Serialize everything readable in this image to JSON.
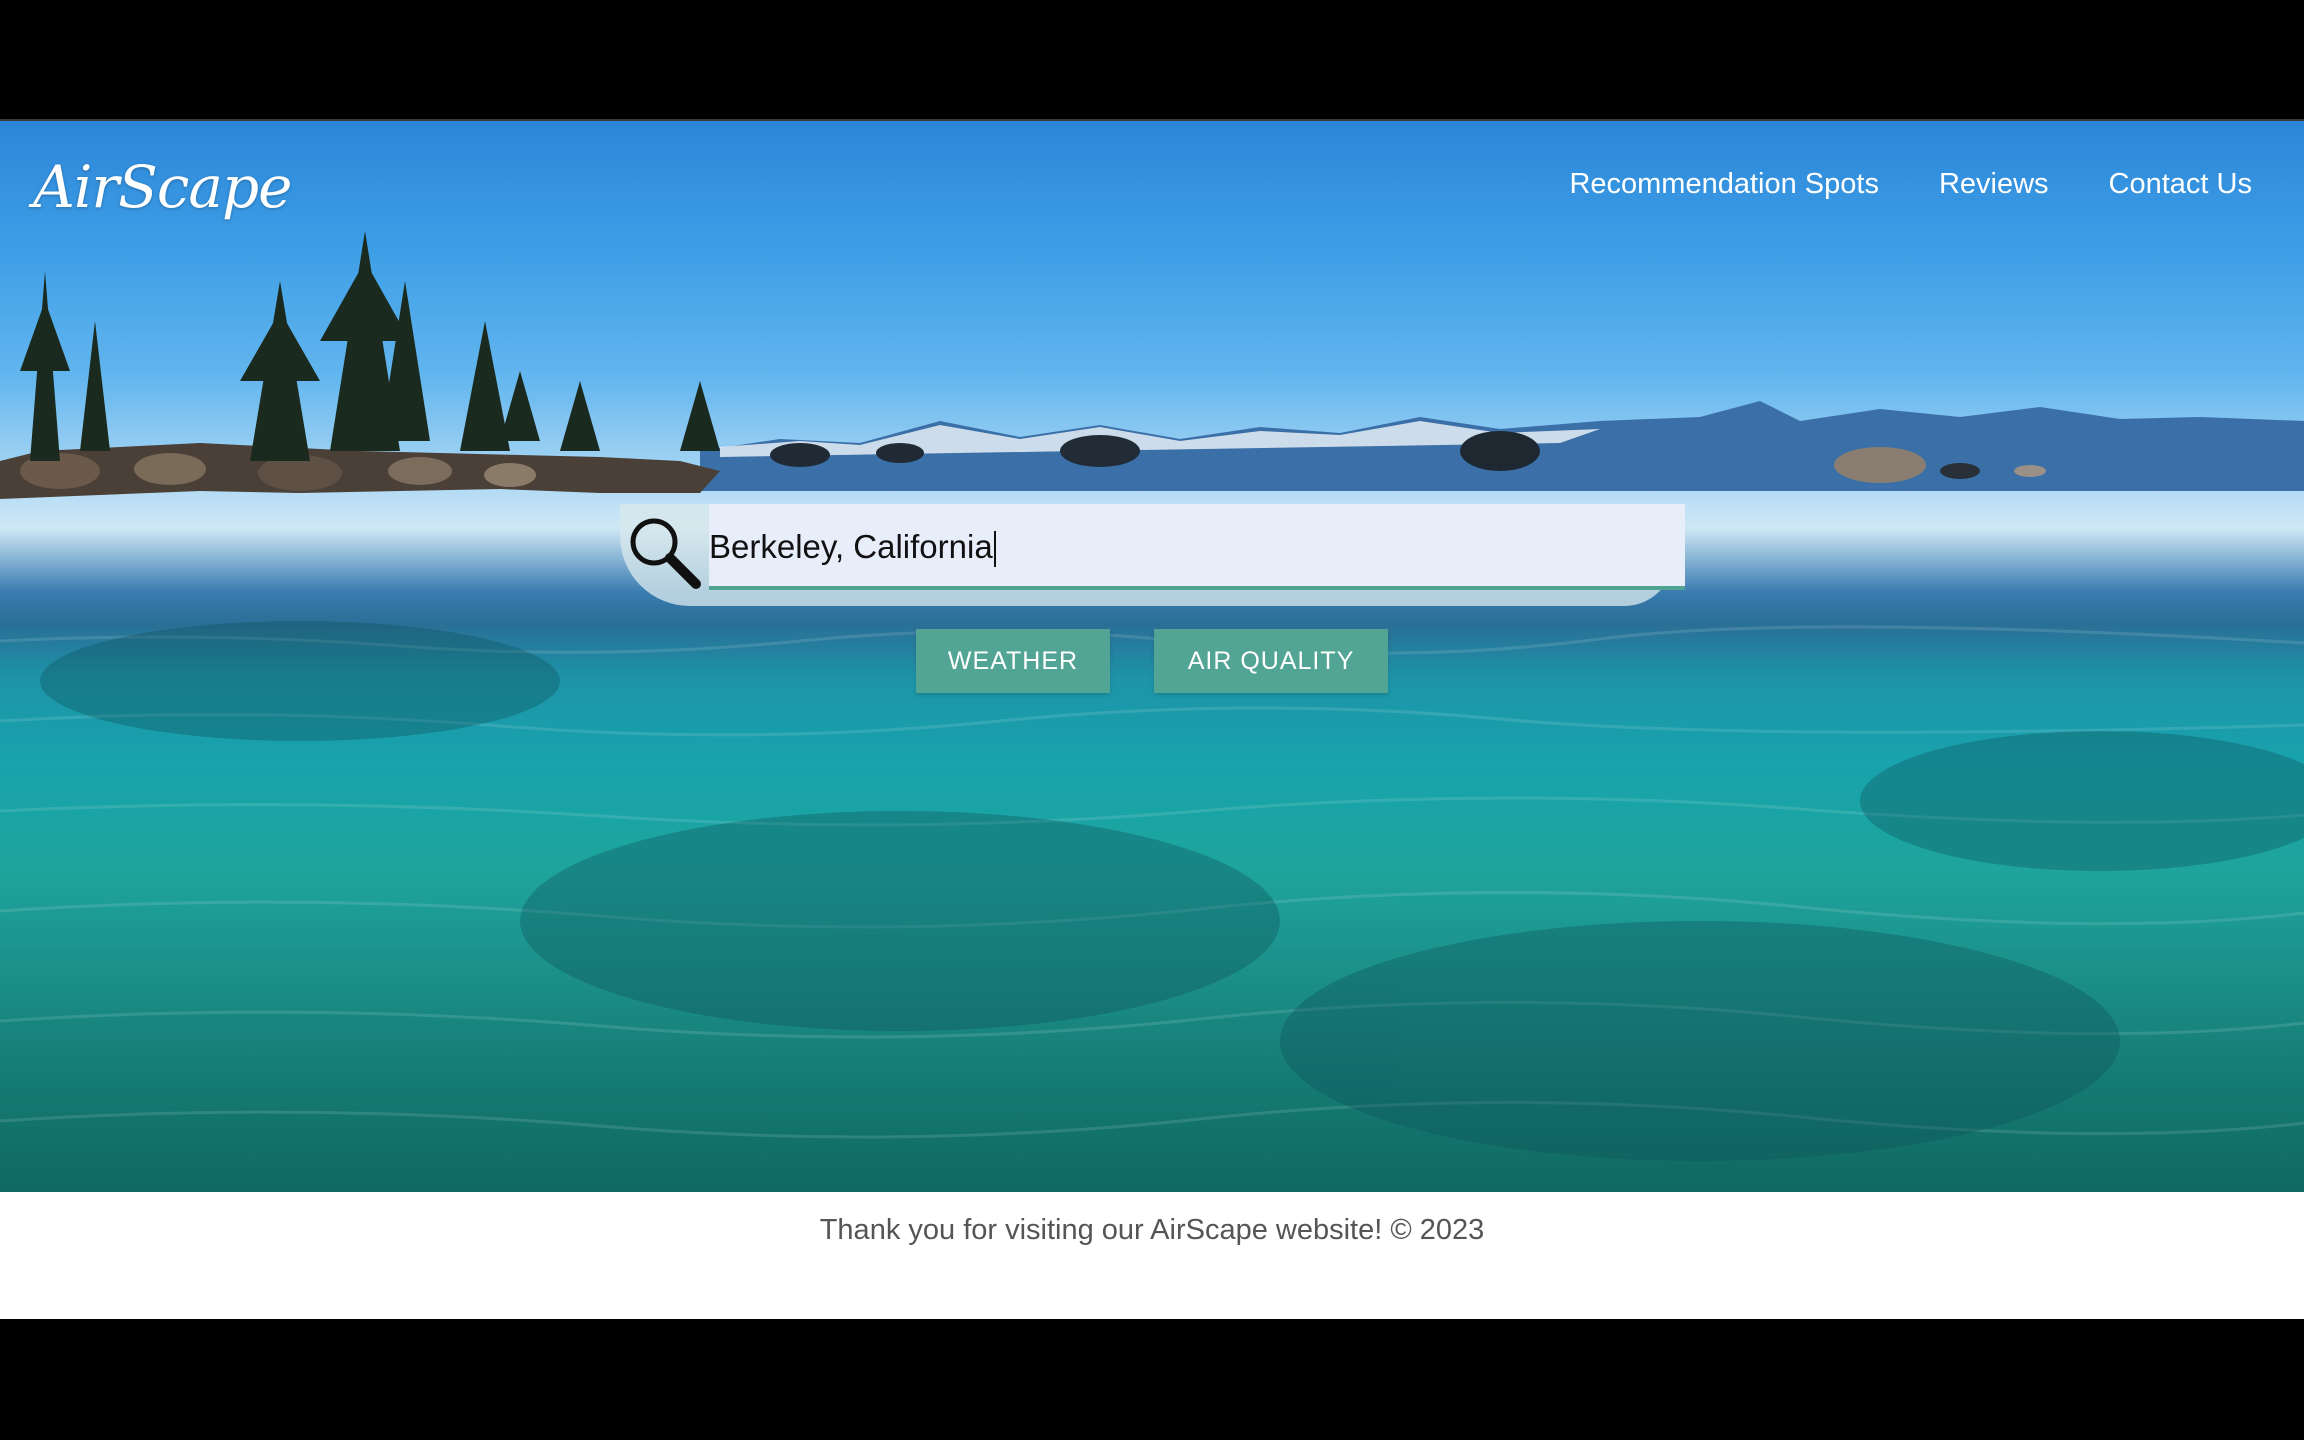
{
  "header": {
    "logo": "AirScape",
    "nav": [
      {
        "label": "Recommendation Spots"
      },
      {
        "label": "Reviews"
      },
      {
        "label": "Contact Us"
      }
    ]
  },
  "search": {
    "value": "Berkeley, California",
    "icon": "search-icon"
  },
  "actions": {
    "weather_label": "WEATHER",
    "air_quality_label": "AIR QUALITY"
  },
  "footer": {
    "text": "Thank you for visiting our AirScape website! © 2023"
  },
  "colors": {
    "button": "#52a594",
    "input_bg": "#e8edfa",
    "input_underline": "#4fa393",
    "footer_text": "#555555"
  }
}
